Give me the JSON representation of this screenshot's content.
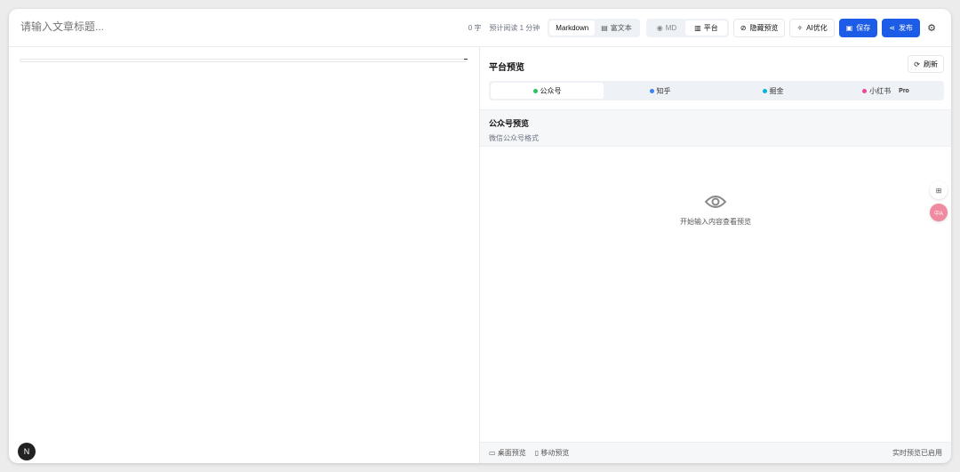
{
  "header": {
    "title_placeholder": "请输入文章标题...",
    "word_count": "0 字",
    "read_time": "预计阅读 1 分钟",
    "mode_tabs": [
      "Markdown",
      "富文本"
    ],
    "view_tabs": [
      "MD",
      "平台"
    ],
    "hide_preview": "隐藏预览",
    "ai_optimize": "AI优化",
    "save": "保存",
    "publish": "发布"
  },
  "preview": {
    "title": "平台预览",
    "refresh": "刷新",
    "platforms": [
      {
        "label": "公众号",
        "color": "#22c55e"
      },
      {
        "label": "知乎",
        "color": "#3b82f6"
      },
      {
        "label": "掘金",
        "color": "#06b6d4"
      },
      {
        "label": "小红书",
        "color": "#ec4899",
        "badge": "Pro"
      }
    ],
    "section_title": "公众号预览",
    "section_subtitle": "微信公众号格式",
    "empty_text": "开始输入内容查看预览",
    "footer": {
      "desktop": "桌面预览",
      "mobile": "移动预览",
      "status": "实时预览已启用"
    }
  },
  "floating": {
    "translate_label": "中A"
  },
  "nav_badge": "N"
}
